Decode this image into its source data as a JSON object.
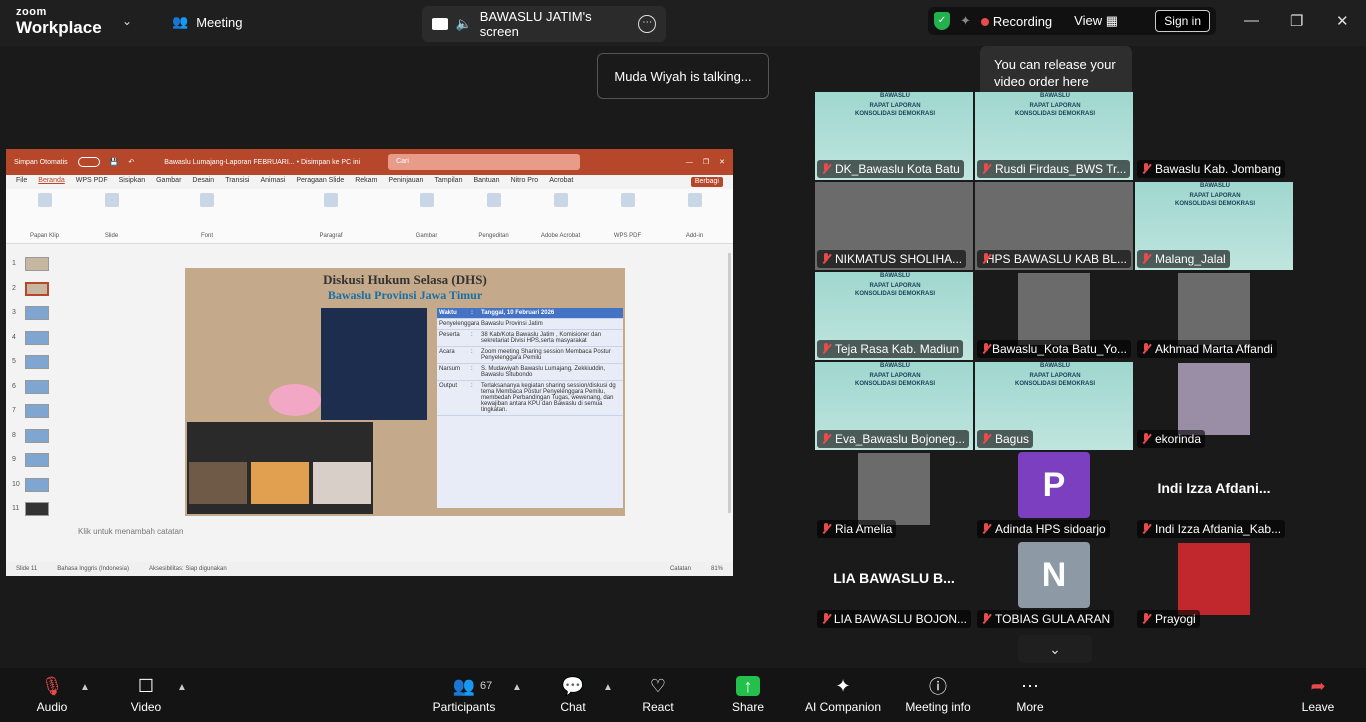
{
  "app": {
    "brand_line1": "zoom",
    "brand_line2": "Workplace",
    "meeting_label": "Meeting"
  },
  "share_tab": {
    "title": "BAWASLU JATIM's screen"
  },
  "top_right": {
    "recording": "Recording",
    "view": "View",
    "sign_in": "Sign in"
  },
  "tooltip": "You can release your video order here",
  "talking": "Muda Wiyah is talking...",
  "ppt": {
    "autosave": "Simpan Otomatis",
    "doc_title": "Bawaslu Lumajang-Laporan FEBRUARI... • Disimpan ke PC ini",
    "search": "Cari",
    "menu": [
      "File",
      "Beranda",
      "WPS PDF",
      "Sisipkan",
      "Gambar",
      "Desain",
      "Transisi",
      "Animasi",
      "Peragaan Slide",
      "Rekam",
      "Peninjauan",
      "Tampilan",
      "Bantuan",
      "Nitro Pro",
      "Acrobat"
    ],
    "share_btn": "Berbagi",
    "ribbon_groups": [
      "Papan Klip",
      "Slide",
      "Font",
      "Paragraf",
      "Gambar",
      "Pengeditan",
      "Adobe Acrobat",
      "WPS PDF",
      "Add-in"
    ],
    "slide_title": "Diskusi Hukum Selasa (DHS)",
    "slide_subtitle": "Bawaslu Provinsi Jawa Timur",
    "table": [
      {
        "k": "Waktu",
        "v": "Tanggal, 10 Februari 2026"
      },
      {
        "k": "Penyelenggara",
        "v": "Bawaslu Provinsi Jatim"
      },
      {
        "k": "Peserta",
        "v": "38 Kab/Kota Bawaslu Jatim , Komisioner dan sekretariat Divisi HPS,serta masyarakat"
      },
      {
        "k": "Acara",
        "v": "Zoom meeting Sharing session Membaca Postur Penyelenggara Pemilu"
      },
      {
        "k": "Narsum",
        "v": "S. Mudawiyah Bawaslu Lumajang, Zekkiuddin, Bawaslu Situbondo"
      },
      {
        "k": "Output",
        "v": "Terlaksananya kegiatan sharing session/diskusi dg tema Membaca Postur Penyelenggara Pemilu, membedah Perbandingan Tugas, wewenang, dan kewajiban antara KPU dan Bawaslu di semua tingkatan."
      }
    ],
    "notes": "Klik untuk menambah catatan",
    "status_lang": "Bahasa Inggris (Indonesia)",
    "status_access": "Aksesibilitas: Siap digunakan",
    "status_notes": "Catatan",
    "zoom": "81%",
    "slide_count": "Slide 11"
  },
  "participants_tiles": [
    {
      "name": "DK_Bawaslu Kota Batu",
      "bg": "banner"
    },
    {
      "name": "Rusdi Firdaus_BWS Tr...",
      "bg": "banner"
    },
    {
      "name": "Bawaslu Kab. Jombang",
      "bg": "dark"
    },
    {
      "name": "NIKMATUS SHOLIHA...",
      "bg": "photo"
    },
    {
      "name": "HPS BAWASLU KAB BL...",
      "bg": "photo"
    },
    {
      "name": "Malang_Jalal",
      "bg": "banner"
    },
    {
      "name": "Teja Rasa Kab. Madiun",
      "bg": "banner"
    },
    {
      "name": "Bawaslu_Kota Batu_Yo...",
      "bg": "dark"
    },
    {
      "name": "Akhmad Marta Affandi",
      "bg": "dark"
    },
    {
      "name": "Eva_Bawaslu Bojoneg...",
      "bg": "banner"
    },
    {
      "name": "Bagus",
      "bg": "banner"
    },
    {
      "name": "ekorinda",
      "bg": "dark"
    },
    {
      "name": "Ria Amelia",
      "bg": "dark"
    },
    {
      "name": "Adinda HPS sidoarjo",
      "bg": "dark",
      "initial": "P",
      "initial_color": "#7b3fbf"
    },
    {
      "name": "Indi Izza Afdania_Kab...",
      "bg": "dark",
      "big": "Indi Izza Afdani..."
    },
    {
      "name": "LIA BAWASLU BOJON...",
      "bg": "dark",
      "big": "LIA BAWASLU B..."
    },
    {
      "name": "TOBIAS GULA ARAN",
      "bg": "dark",
      "initial": "N",
      "initial_color": "#8d9aa5"
    },
    {
      "name": "Prayogi",
      "bg": "dark"
    }
  ],
  "banner_title": "RAPAT LAPORAN KONSOLIDASI DEMOKRASI",
  "banner_brand": "BAWASLU",
  "toolbar": {
    "audio": "Audio",
    "video": "Video",
    "participants": "Participants",
    "participants_count": "67",
    "chat": "Chat",
    "react": "React",
    "share": "Share",
    "ai": "AI Companion",
    "info": "Meeting info",
    "more": "More",
    "leave": "Leave"
  }
}
